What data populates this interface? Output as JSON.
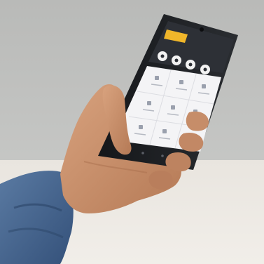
{
  "photo": {
    "subject": "hand-holding-smartphone",
    "colors": {
      "wall": "#c0c1bf",
      "table": "#ece8e2",
      "sleeve": "#3f5f86",
      "skin": "#c9906b",
      "phone_body": "#1f2226",
      "app_header": "#2d3036",
      "accent": "#f0b62a",
      "app_grid": "#f4f4f6"
    },
    "screen": {
      "header_badge": "",
      "header_caption": "",
      "round_buttons": [
        "",
        "",
        "",
        ""
      ],
      "grid_labels": [
        "",
        "",
        "",
        "",
        "",
        "",
        "",
        "",
        "",
        "",
        "",
        ""
      ]
    }
  }
}
